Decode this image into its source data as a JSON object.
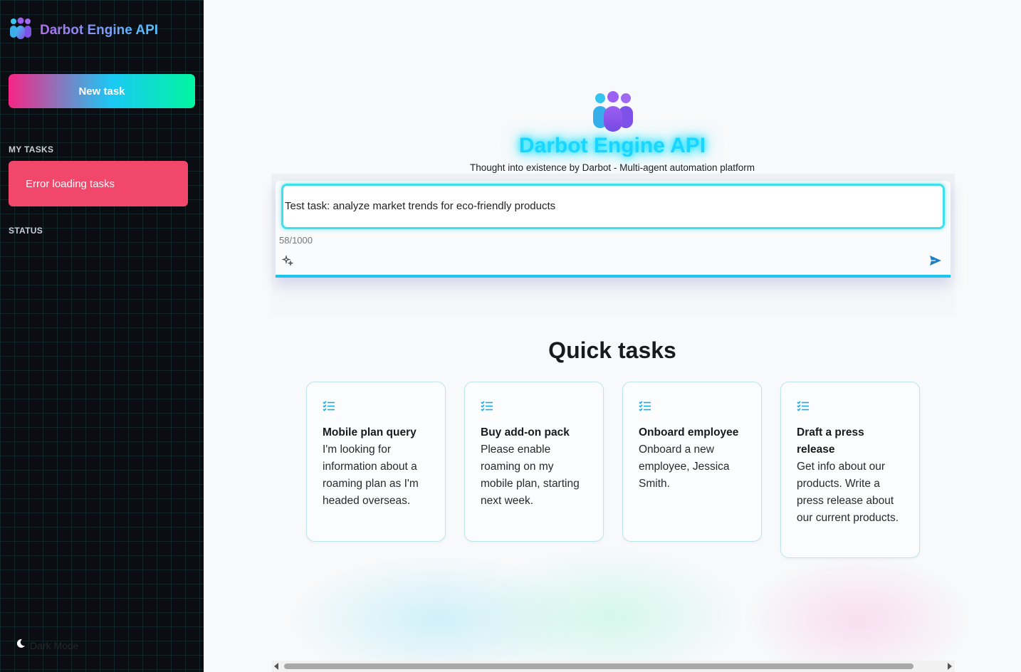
{
  "sidebar": {
    "brand_name": "Darbot Engine API",
    "brand_icon": "people-group-icon",
    "new_task_label": "New task",
    "my_tasks_label": "MY TASKS",
    "error_message": "Error loading tasks",
    "status_label": "STATUS",
    "dark_mode_label": "Dark Mode"
  },
  "hero": {
    "title": "Darbot Engine API",
    "subtitle": "Thought into existence by Darbot - Multi-agent automation platform"
  },
  "task_input": {
    "value": "Test task: analyze market trends for eco-friendly products",
    "char_count": "58/1000"
  },
  "quick_tasks": {
    "title": "Quick tasks",
    "cards": [
      {
        "title": "Mobile plan query",
        "description": "I'm looking for information about a roaming plan as I'm headed overseas."
      },
      {
        "title": "Buy add-on pack",
        "description": "Please enable roaming on my mobile plan, starting next week."
      },
      {
        "title": "Onboard employee",
        "description": "Onboard a new employee, Jessica Smith."
      },
      {
        "title": "Draft a press release",
        "description": "Get info about our products. Write a press release about our current products."
      }
    ]
  },
  "colors": {
    "accent_cyan": "#1ad5ff",
    "error_red": "#f0476a",
    "sidebar_bg": "#0b0d12"
  }
}
